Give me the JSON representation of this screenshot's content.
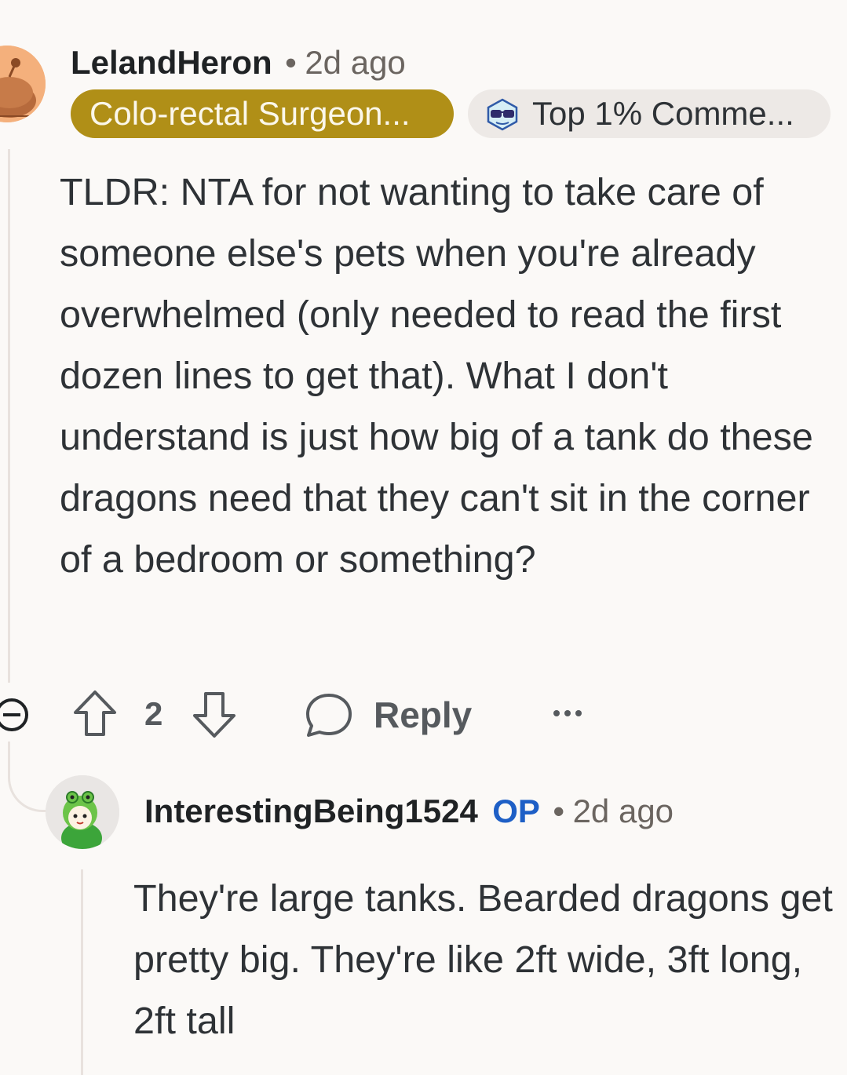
{
  "comment": {
    "author": "LelandHeron",
    "separator": "•",
    "time": "2d ago",
    "flair": "Colo-rectal Surgeon...",
    "badge": "Top 1% Comme...",
    "body": "TLDR: NTA for not wanting to take care of someone else's pets when you're already overwhelmed (only needed to read the first dozen lines to get that). What I don't understand is just how big of a tank do these dragons need that they can't sit in the corner of a bedroom or something?",
    "vote_count": "2",
    "reply_label": "Reply",
    "more_label": "..."
  },
  "reply": {
    "author": "InterestingBeing1524",
    "op_label": "OP",
    "separator": "•",
    "time": "2d ago",
    "body": "They're large tanks. Bearded dragons get pretty big. They're like 2ft wide, 3ft long, 2ft tall"
  },
  "colors": {
    "flair_bg": "#b08f17",
    "op_blue": "#1e5fc6",
    "background": "#fbf9f7"
  },
  "icons": [
    "snoo-avatar",
    "sunglasses-icon",
    "collapse-icon",
    "upvote-icon",
    "downvote-icon",
    "comment-bubble-icon",
    "more-options-icon",
    "frog-hat-avatar"
  ]
}
